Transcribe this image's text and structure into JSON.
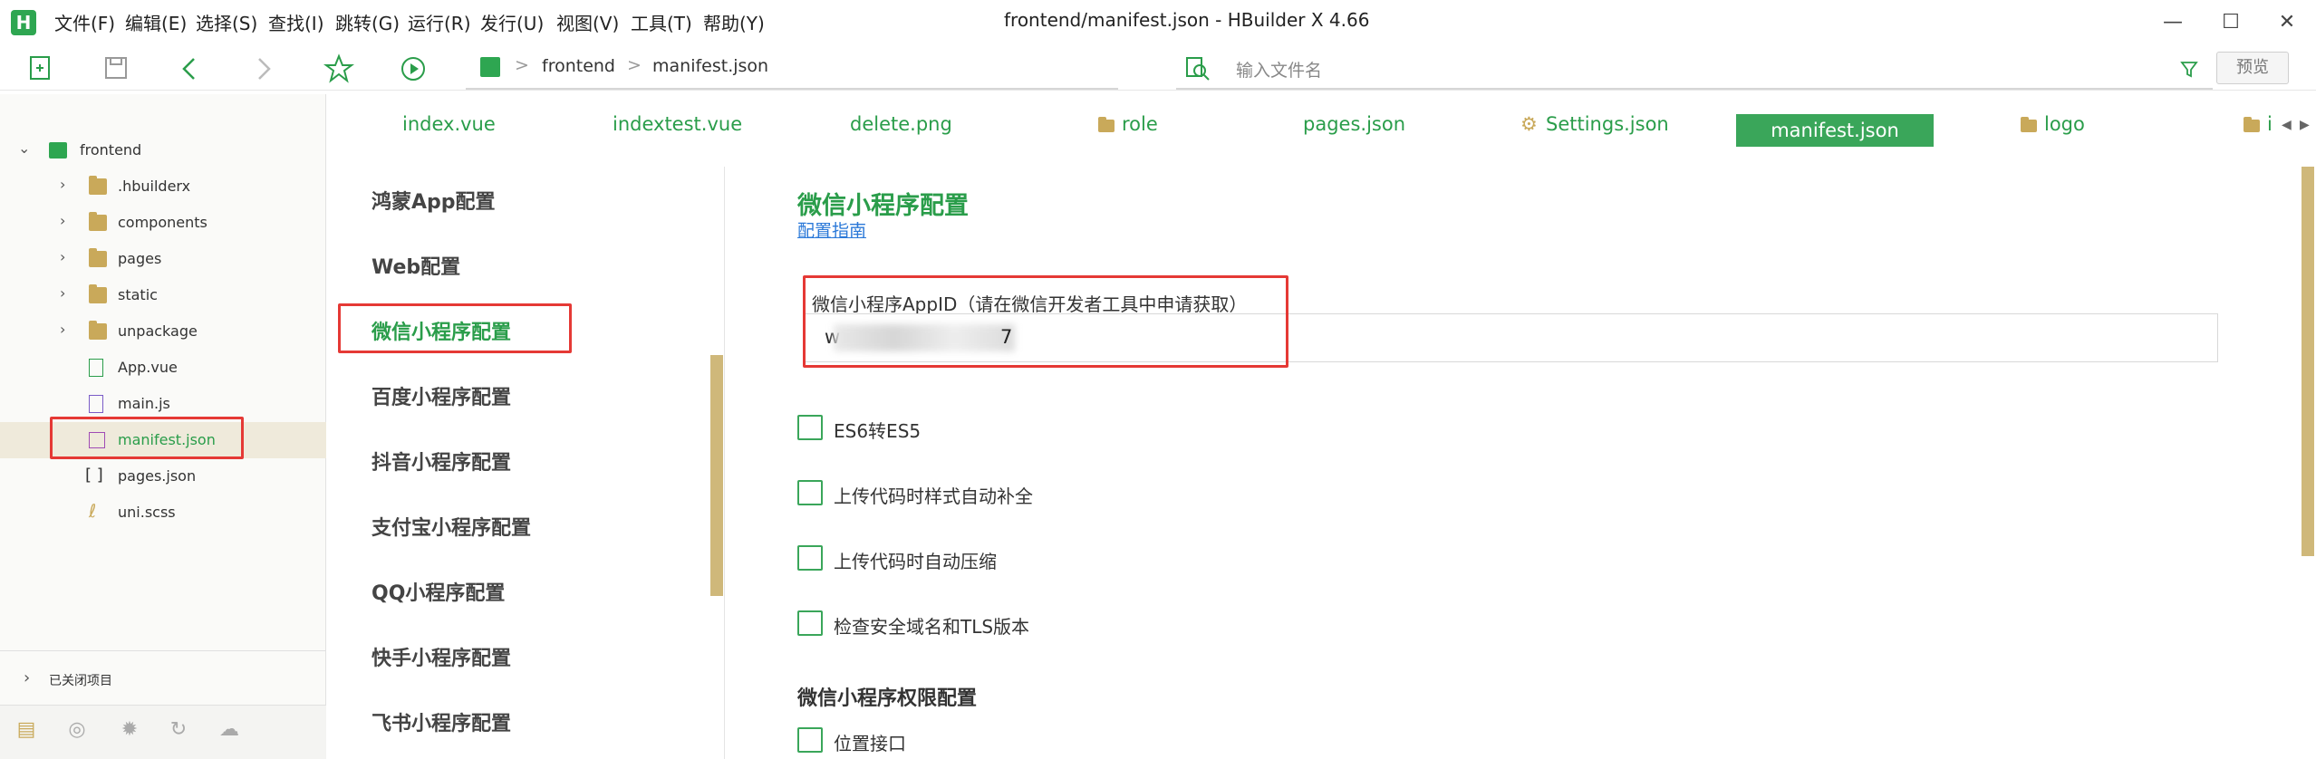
{
  "menubar": {
    "items": [
      "文件(F)",
      "编辑(E)",
      "选择(S)",
      "查找(I)",
      "跳转(G)",
      "运行(R)",
      "发行(U)",
      "视图(V)",
      "工具(T)",
      "帮助(Y)"
    ],
    "window_title": "frontend/manifest.json - HBuilder X 4.66",
    "logo": "H"
  },
  "toolbar": {
    "breadcrumb": [
      "frontend",
      "manifest.json"
    ],
    "search_placeholder": "输入文件名",
    "preview_label": "预览",
    "icons": [
      "new-file-icon",
      "save-icon",
      "back-icon",
      "forward-icon",
      "favorite-icon",
      "run-icon",
      "project-icon",
      "search-file-icon",
      "filter-icon"
    ]
  },
  "sidebar": {
    "project": "frontend",
    "items": [
      {
        "label": ".hbuilderx",
        "type": "folder"
      },
      {
        "label": "components",
        "type": "folder"
      },
      {
        "label": "pages",
        "type": "folder"
      },
      {
        "label": "static",
        "type": "folder"
      },
      {
        "label": "unpackage",
        "type": "folder"
      },
      {
        "label": "App.vue",
        "type": "vue"
      },
      {
        "label": "main.js",
        "type": "js"
      },
      {
        "label": "manifest.json",
        "type": "manifest"
      },
      {
        "label": "pages.json",
        "type": "json"
      },
      {
        "label": "uni.scss",
        "type": "scss"
      }
    ],
    "closed_projects": "已关闭项目"
  },
  "tabs": {
    "items": [
      "index.vue",
      "indextest.vue",
      "delete.png",
      "role",
      "pages.json",
      "Settings.json",
      "manifest.json",
      "logo",
      "i"
    ],
    "active": "manifest.json"
  },
  "nav": {
    "items": [
      "鸿蒙App配置",
      "Web配置",
      "微信小程序配置",
      "百度小程序配置",
      "抖音小程序配置",
      "支付宝小程序配置",
      "QQ小程序配置",
      "快手小程序配置",
      "飞书小程序配置"
    ],
    "active": "微信小程序配置"
  },
  "main": {
    "title": "微信小程序配置",
    "guide_link": "配置指南",
    "appid_label": "微信小程序AppID（请在微信开发者工具中申请获取）",
    "appid_value_start": "w",
    "appid_value_end": "7",
    "checkboxes": [
      "ES6转ES5",
      "上传代码时样式自动补全",
      "上传代码时自动压缩",
      "检查安全域名和TLS版本"
    ],
    "perm_title": "微信小程序权限配置",
    "perm_items": [
      "位置接口"
    ]
  },
  "colors": {
    "accent": "#2a9d4a",
    "active_tab_bg": "#3aa65a",
    "highlight": "#e53935",
    "scrollbar": "#cfb87a"
  }
}
